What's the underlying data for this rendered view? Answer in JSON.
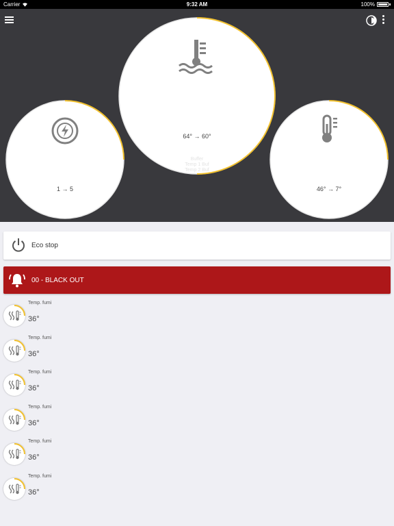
{
  "statusbar": {
    "carrier": "Carrier",
    "time": "9:32 AM",
    "battery": "100%"
  },
  "header": {
    "gauges": [
      {
        "value": "1 → 5",
        "icon": "power-gauge-icon",
        "fill_pct": 25
      },
      {
        "value": "64° → 60°",
        "icon": "water-temperature-icon",
        "fill_pct": 50
      },
      {
        "value": "46° → 7°",
        "icon": "thermometer-icon",
        "fill_pct": 25
      }
    ],
    "faint_lines": [
      "Buffer",
      "Temp 1 Buf",
      "Temp 2 Buf"
    ]
  },
  "eco": {
    "label": "Eco stop",
    "icon": "power-icon"
  },
  "alarm": {
    "label": "00 - BLACK OUT",
    "icon": "bell-alarm-icon"
  },
  "list": [
    {
      "label": "Temp. fumi",
      "value": "36°"
    },
    {
      "label": "Temp. fumi",
      "value": "36°"
    },
    {
      "label": "Temp. fumi",
      "value": "36°"
    },
    {
      "label": "Temp. fumi",
      "value": "36°"
    },
    {
      "label": "Temp. fumi",
      "value": "36°"
    },
    {
      "label": "Temp. fumi",
      "value": "36°"
    }
  ],
  "colors": {
    "header_bg": "#39393d",
    "gauge_ring": "#f2c12e",
    "alarm_bg": "#ad1719",
    "page_bg": "#efeff4"
  }
}
